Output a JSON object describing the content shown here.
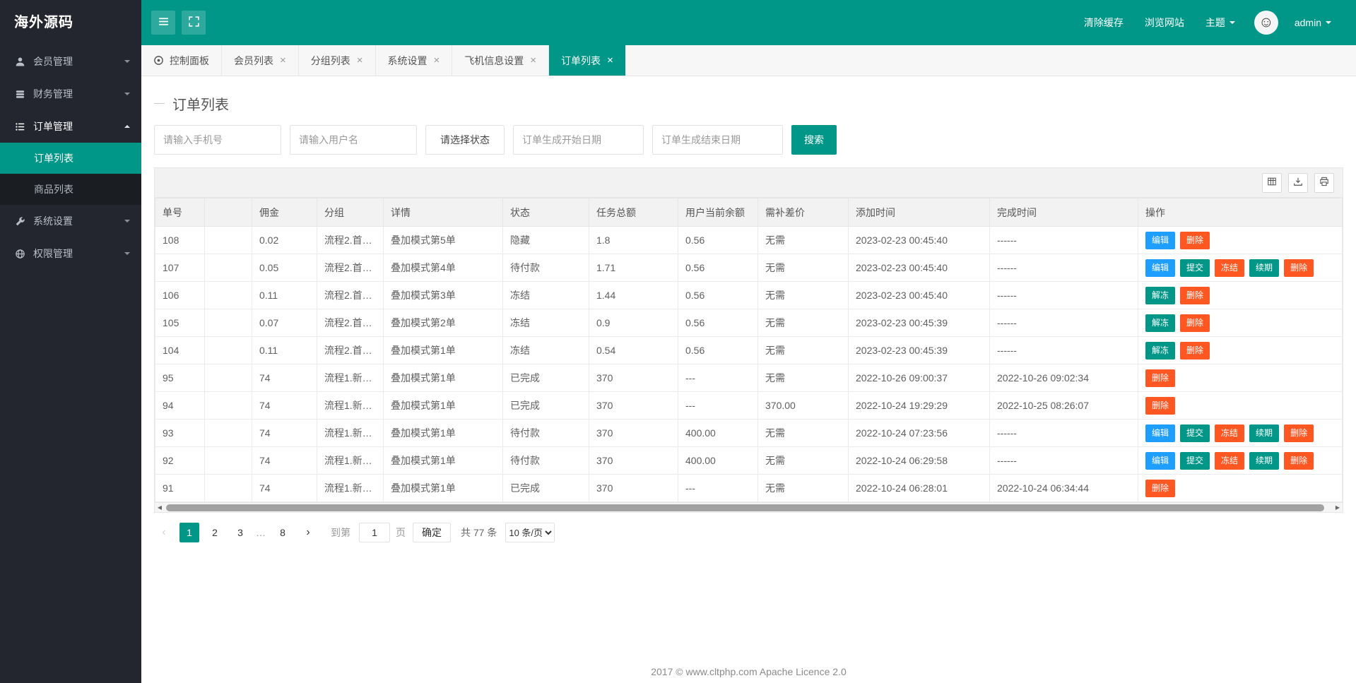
{
  "logo": "海外源码",
  "header": {
    "buttons": [
      {
        "name": "menu-toggle",
        "icon": "hamburger-icon"
      },
      {
        "name": "fullscreen",
        "icon": "expand-icon"
      }
    ],
    "clear_cache": "清除缓存",
    "browse_site": "浏览网站",
    "theme": "主题",
    "username": "admin",
    "avatar_icon": "smiley-icon"
  },
  "sidebar": [
    {
      "label": "会员管理",
      "icon": "member-icon",
      "state": "collapsed"
    },
    {
      "label": "财务管理",
      "icon": "finance-icon",
      "state": "collapsed"
    },
    {
      "label": "订单管理",
      "icon": "order-icon",
      "state": "expanded",
      "children": [
        {
          "label": "订单列表",
          "active": true
        },
        {
          "label": "商品列表",
          "active": false
        }
      ]
    },
    {
      "label": "系统设置",
      "icon": "system-icon",
      "state": "collapsed"
    },
    {
      "label": "权限管理",
      "icon": "permission-icon",
      "state": "collapsed"
    }
  ],
  "tabs": [
    {
      "label": "控制面板",
      "icon": "console-icon",
      "closable": false,
      "active": false
    },
    {
      "label": "会员列表",
      "closable": true,
      "active": false
    },
    {
      "label": "分组列表",
      "closable": true,
      "active": false
    },
    {
      "label": "系统设置",
      "closable": true,
      "active": false
    },
    {
      "label": "飞机信息设置",
      "closable": true,
      "active": false
    },
    {
      "label": "订单列表",
      "closable": true,
      "active": true
    }
  ],
  "page_title": "订单列表",
  "filters": {
    "phone_placeholder": "请输入手机号",
    "username_placeholder": "请输入用户名",
    "status_placeholder": "请选择状态",
    "start_date_placeholder": "订单生成开始日期",
    "end_date_placeholder": "订单生成结束日期",
    "search_button": "搜索"
  },
  "toolbar": [
    {
      "name": "filter-columns",
      "icon": "cols-icon"
    },
    {
      "name": "export",
      "icon": "export-icon"
    },
    {
      "name": "print",
      "icon": "print-icon"
    }
  ],
  "table": {
    "columns": [
      "单号",
      "",
      "佣金",
      "分组",
      "详情",
      "状态",
      "任务总额",
      "用户当前余额",
      "需补差价",
      "添加时间",
      "完成时间",
      "操作"
    ],
    "rows": [
      {
        "cells": [
          "108",
          "",
          "0.02",
          "流程2.首…",
          "叠加模式第5单",
          "隐藏",
          "1.8",
          "0.56",
          "无需",
          "2023-02-23 00:45:40",
          "------"
        ],
        "actions": [
          {
            "label": "编辑",
            "name": "edit",
            "color": "blue"
          },
          {
            "label": "删除",
            "name": "delete",
            "color": "red"
          }
        ]
      },
      {
        "cells": [
          "107",
          "",
          "0.05",
          "流程2.首…",
          "叠加模式第4单",
          "待付款",
          "1.71",
          "0.56",
          "无需",
          "2023-02-23 00:45:40",
          "------"
        ],
        "actions": [
          {
            "label": "编辑",
            "name": "edit",
            "color": "blue"
          },
          {
            "label": "提交",
            "name": "submit",
            "color": "green"
          },
          {
            "label": "冻结",
            "name": "freeze",
            "color": "red"
          },
          {
            "label": "续期",
            "name": "renew",
            "color": "green"
          },
          {
            "label": "删除",
            "name": "delete",
            "color": "red"
          }
        ]
      },
      {
        "cells": [
          "106",
          "",
          "0.11",
          "流程2.首…",
          "叠加模式第3单",
          "冻结",
          "1.44",
          "0.56",
          "无需",
          "2023-02-23 00:45:40",
          "------"
        ],
        "actions": [
          {
            "label": "解冻",
            "name": "unfreeze",
            "color": "green"
          },
          {
            "label": "删除",
            "name": "delete",
            "color": "red"
          }
        ]
      },
      {
        "cells": [
          "105",
          "",
          "0.07",
          "流程2.首…",
          "叠加模式第2单",
          "冻结",
          "0.9",
          "0.56",
          "无需",
          "2023-02-23 00:45:39",
          "------"
        ],
        "actions": [
          {
            "label": "解冻",
            "name": "unfreeze",
            "color": "green"
          },
          {
            "label": "删除",
            "name": "delete",
            "color": "red"
          }
        ]
      },
      {
        "cells": [
          "104",
          "",
          "0.11",
          "流程2.首…",
          "叠加模式第1单",
          "冻结",
          "0.54",
          "0.56",
          "无需",
          "2023-02-23 00:45:39",
          "------"
        ],
        "actions": [
          {
            "label": "解冻",
            "name": "unfreeze",
            "color": "green"
          },
          {
            "label": "删除",
            "name": "delete",
            "color": "red"
          }
        ]
      },
      {
        "cells": [
          "95",
          "",
          "74",
          "流程1.新…",
          "叠加模式第1单",
          "已完成",
          "370",
          "---",
          "无需",
          "2022-10-26 09:00:37",
          "2022-10-26 09:02:34"
        ],
        "actions": [
          {
            "label": "删除",
            "name": "delete",
            "color": "red"
          }
        ]
      },
      {
        "cells": [
          "94",
          "",
          "74",
          "流程1.新…",
          "叠加模式第1单",
          "已完成",
          "370",
          "---",
          "370.00",
          "2022-10-24 19:29:29",
          "2022-10-25 08:26:07"
        ],
        "actions": [
          {
            "label": "删除",
            "name": "delete",
            "color": "red"
          }
        ]
      },
      {
        "cells": [
          "93",
          "",
          "74",
          "流程1.新…",
          "叠加模式第1单",
          "待付款",
          "370",
          "400.00",
          "无需",
          "2022-10-24 07:23:56",
          "------"
        ],
        "actions": [
          {
            "label": "编辑",
            "name": "edit",
            "color": "blue"
          },
          {
            "label": "提交",
            "name": "submit",
            "color": "green"
          },
          {
            "label": "冻结",
            "name": "freeze",
            "color": "red"
          },
          {
            "label": "续期",
            "name": "renew",
            "color": "green"
          },
          {
            "label": "删除",
            "name": "delete",
            "color": "red"
          }
        ]
      },
      {
        "cells": [
          "92",
          "",
          "74",
          "流程1.新…",
          "叠加模式第1单",
          "待付款",
          "370",
          "400.00",
          "无需",
          "2022-10-24 06:29:58",
          "------"
        ],
        "actions": [
          {
            "label": "编辑",
            "name": "edit",
            "color": "blue"
          },
          {
            "label": "提交",
            "name": "submit",
            "color": "green"
          },
          {
            "label": "冻结",
            "name": "freeze",
            "color": "red"
          },
          {
            "label": "续期",
            "name": "renew",
            "color": "green"
          },
          {
            "label": "删除",
            "name": "delete",
            "color": "red"
          }
        ]
      },
      {
        "cells": [
          "91",
          "",
          "74",
          "流程1.新…",
          "叠加模式第1单",
          "已完成",
          "370",
          "---",
          "无需",
          "2022-10-24 06:28:01",
          "2022-10-24 06:34:44"
        ],
        "actions": [
          {
            "label": "删除",
            "name": "delete",
            "color": "red"
          }
        ]
      }
    ]
  },
  "pagination": {
    "pages": [
      "1",
      "2",
      "3",
      "…",
      "8"
    ],
    "current": "1",
    "jump_prefix": "到第",
    "jump_value": "1",
    "jump_suffix": "页",
    "confirm": "确定",
    "total": "共 77 条",
    "page_size": "10 条/页"
  },
  "glyphs": {
    "close": "×",
    "prev": "‹",
    "next": "›",
    "scroll_left": "◀",
    "scroll_right": "▶",
    "smiley": "☺"
  },
  "colors": {
    "accent": "#009688",
    "edit_blue": "#1E9FFF",
    "danger_red": "#FF5722",
    "sidebar_dark": "#23262e"
  },
  "footer": "2017 ©  www.cltphp.com  Apache Licence 2.0"
}
